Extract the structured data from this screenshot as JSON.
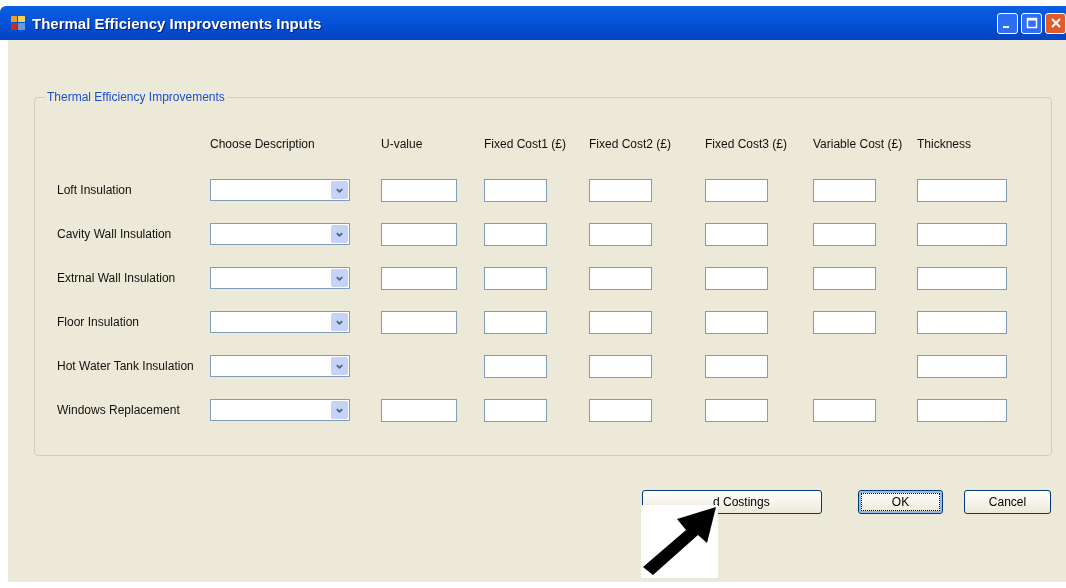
{
  "window": {
    "title": "Thermal Efficiency Improvements Inputs"
  },
  "group": {
    "title": "Thermal Efficiency Improvements",
    "columns": [
      "Choose Description",
      "U-value",
      "Fixed Cost1 (£)",
      "Fixed Cost2 (£)",
      "Fixed Cost3 (£)",
      "Variable Cost (£)",
      "Thickness"
    ],
    "rows": [
      {
        "label": "Loft Insulation",
        "u_value_field": true,
        "variable_cost_field": true
      },
      {
        "label": "Cavity Wall Insulation",
        "u_value_field": true,
        "variable_cost_field": true
      },
      {
        "label": "Extrnal Wall Insulation",
        "u_value_field": true,
        "variable_cost_field": true
      },
      {
        "label": "Floor Insulation",
        "u_value_field": true,
        "variable_cost_field": true
      },
      {
        "label": "Hot Water Tank Insulation",
        "u_value_field": false,
        "variable_cost_field": false
      },
      {
        "label": "Windows Replacement",
        "u_value_field": true,
        "variable_cost_field": true
      }
    ]
  },
  "buttons": [
    {
      "label": "d Costings",
      "focused": false
    },
    {
      "label": "OK",
      "focused": true
    },
    {
      "label": "Cancel",
      "focused": false
    }
  ]
}
